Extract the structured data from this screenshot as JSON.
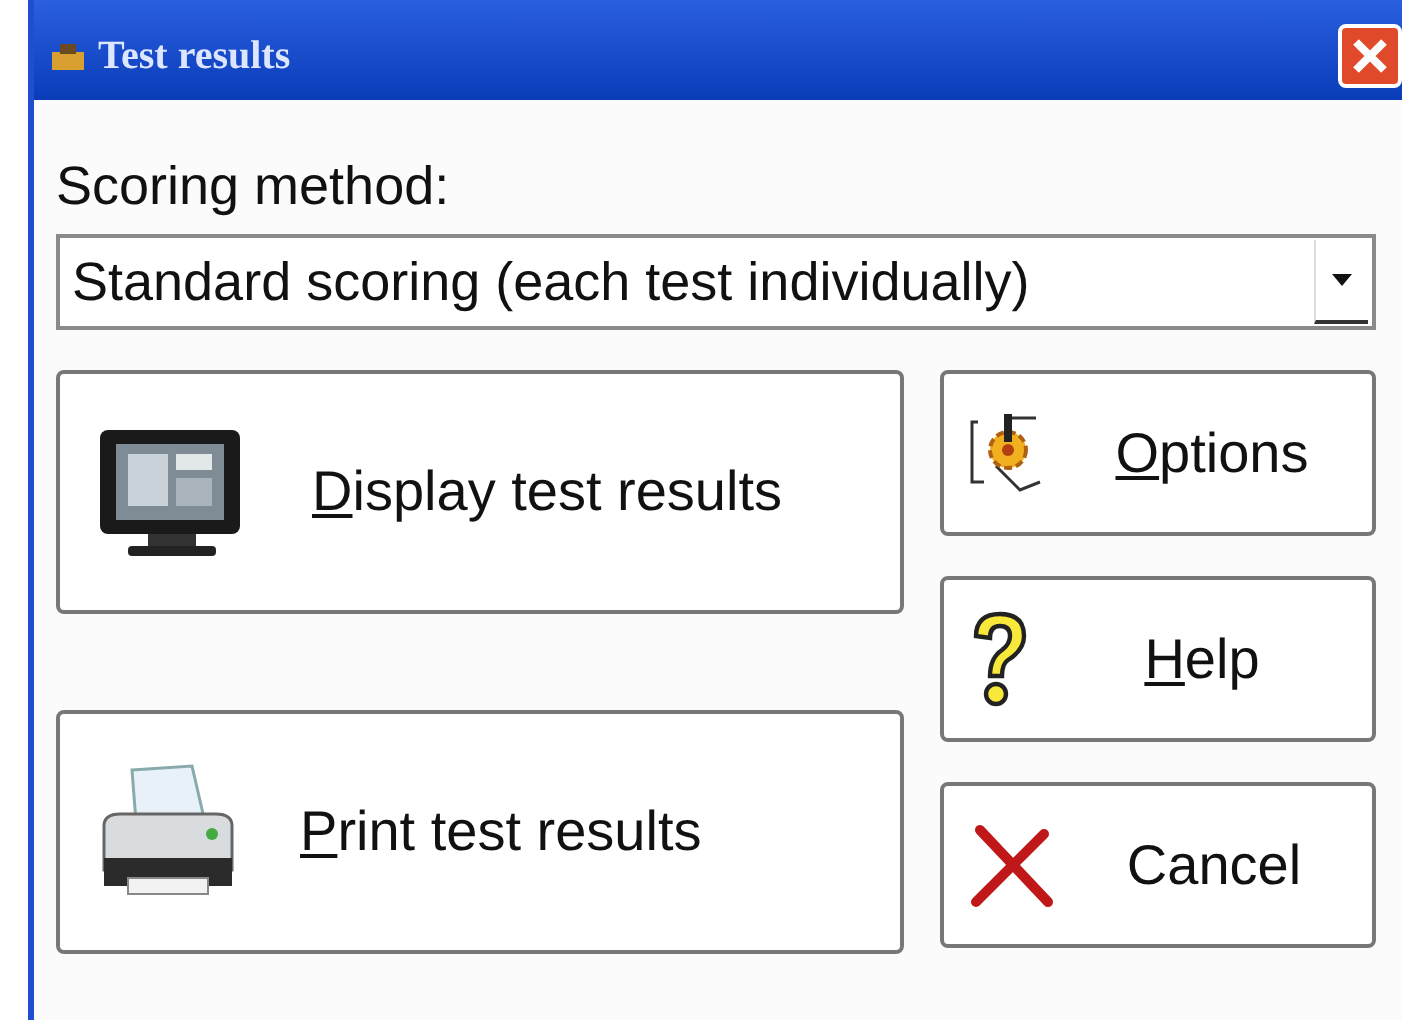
{
  "window": {
    "title": "Test results"
  },
  "scoring": {
    "label": "Scoring method:",
    "value": "Standard scoring (each test individually)"
  },
  "main_buttons": [
    {
      "label": "Display test results",
      "first_letter_underlined": true
    },
    {
      "label": "Print test results",
      "first_letter_underlined": true
    }
  ],
  "side_buttons": [
    {
      "label": "Options",
      "first_letter_underlined": true
    },
    {
      "label": "Help",
      "first_letter_underlined": true
    },
    {
      "label": "Cancel",
      "first_letter_underlined": false
    }
  ]
}
